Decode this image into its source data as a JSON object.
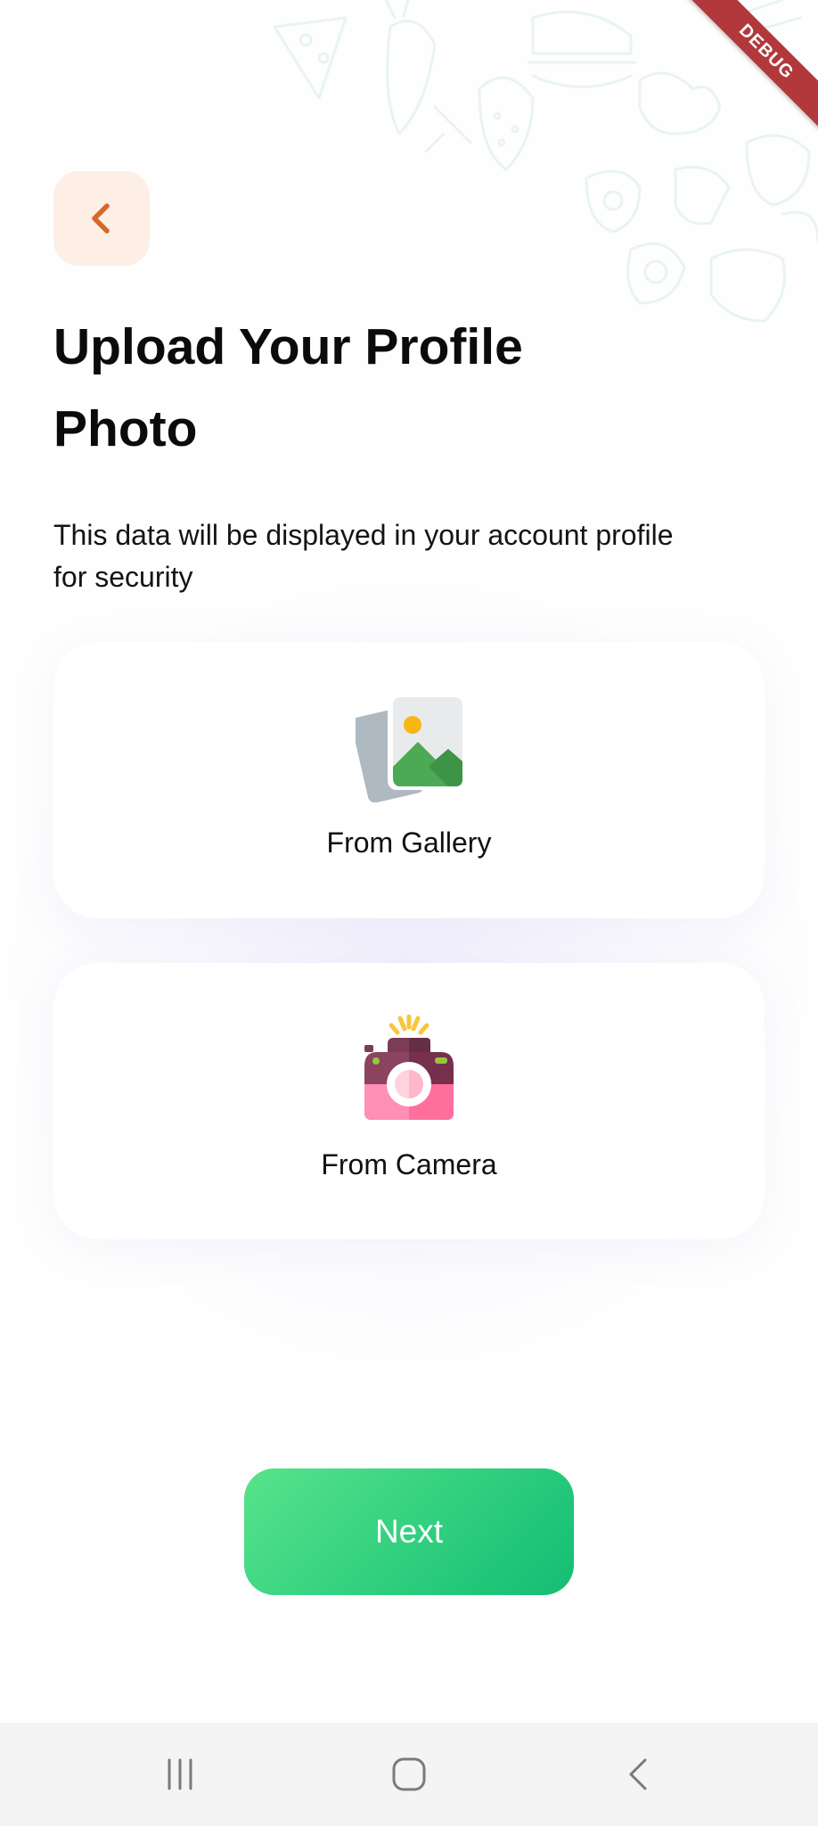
{
  "debug_banner": "DEBUG",
  "header": {
    "back_icon": "chevron-left-icon"
  },
  "title": "Upload Your Profile Photo",
  "subtitle": "This data will be displayed in your account profile for security",
  "options": [
    {
      "label": "From Gallery",
      "icon": "gallery-icon"
    },
    {
      "label": "From Camera",
      "icon": "camera-icon"
    }
  ],
  "next_button": {
    "label": "Next"
  },
  "nav_bar": {
    "recents_icon": "recents-icon",
    "home_icon": "home-icon",
    "back_icon": "back-icon"
  },
  "colors": {
    "accent_orange": "#d4692a",
    "back_button_bg": "#fdefe6",
    "button_gradient_start": "#58e38c",
    "button_gradient_end": "#14bd74"
  }
}
